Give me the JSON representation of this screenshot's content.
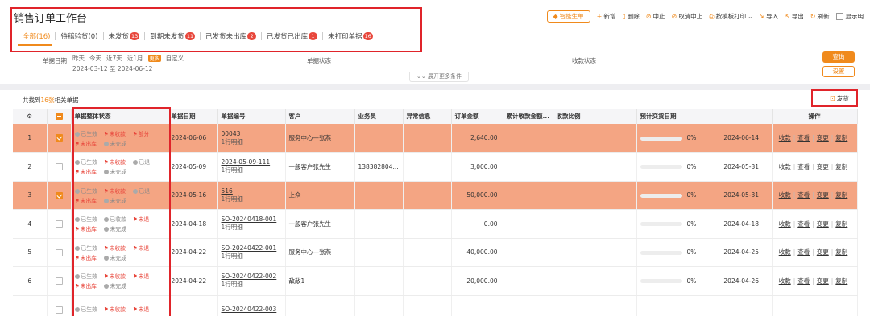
{
  "header": {
    "title": "销售订单工作台"
  },
  "tabs": [
    {
      "label": "全部(16)",
      "badge": ""
    },
    {
      "label": "待稽验货(0)",
      "badge": ""
    },
    {
      "label": "未发货",
      "badge": "13"
    },
    {
      "label": "到期未发货",
      "badge": "11"
    },
    {
      "label": "已发货未出库",
      "badge": "2"
    },
    {
      "label": "已发货已出库",
      "badge": "1"
    },
    {
      "label": "未打印单据",
      "badge": "16"
    }
  ],
  "toolbar": {
    "smart_label": "智能生单",
    "items": [
      "新增",
      "删除",
      "中止",
      "取消中止",
      "按模板打印",
      "导入",
      "导出",
      "刷新"
    ],
    "show_label": "显示明"
  },
  "filters": {
    "date_label": "单据日期",
    "date_opts": [
      "昨天",
      "今天",
      "近7天",
      "近1月"
    ],
    "more_badge": "更多",
    "custom": "自定义",
    "range": "2024-03-12 至 2024-06-12",
    "status_label": "单据状态",
    "collect_label": "收款状态",
    "expand_label": "展开更多条件",
    "query_label": "查询",
    "reset_label": "设置"
  },
  "summary": {
    "prefix": "共找到",
    "count": "16张",
    "suffix": "相关单据"
  },
  "ship_label": "发货",
  "table": {
    "headers": [
      "单据整体状态",
      "单据日期",
      "单据编号",
      "客户",
      "业务员",
      "异常信息",
      "订单金额",
      "累计收款金额...",
      "收款比例",
      "预计交货日期",
      "操作"
    ],
    "ops": [
      "收款",
      "查看",
      "变更",
      "复制"
    ],
    "rows": [
      {
        "idx": "1",
        "checked": true,
        "st": [
          "已生效",
          "未收款",
          "部分",
          "未出库",
          "未完成"
        ],
        "date": "2024-06-06",
        "no": "00043",
        "lines": "1行明细",
        "customer": "服务中心—张燕",
        "sales": "",
        "amount": "2,640.00",
        "ratio": "0%",
        "due": "2024-06-14"
      },
      {
        "idx": "2",
        "checked": false,
        "st": [
          "已生效",
          "未收款",
          "已退",
          "未出库",
          "未完成"
        ],
        "date": "2024-05-09",
        "no": "2024-05-09-111",
        "lines": "1行明细",
        "customer": "一般客户张先生",
        "sales": "138382804...",
        "amount": "3,000.00",
        "ratio": "0%",
        "due": "2024-05-31"
      },
      {
        "idx": "3",
        "checked": true,
        "st": [
          "已生效",
          "未收款",
          "已退",
          "未出库",
          "未完成"
        ],
        "date": "2024-05-16",
        "no": "516",
        "lines": "1行明细",
        "customer": "上众",
        "sales": "",
        "amount": "50,000.00",
        "ratio": "0%",
        "due": "2024-05-31"
      },
      {
        "idx": "4",
        "checked": false,
        "st": [
          "已生效",
          "已收款",
          "未退",
          "未出库",
          "未完成"
        ],
        "date": "2024-04-18",
        "no": "SO-20240418-001",
        "lines": "1行明细",
        "customer": "一般客户张先生",
        "sales": "",
        "amount": "0.00",
        "ratio": "0%",
        "due": "2024-04-18"
      },
      {
        "idx": "5",
        "checked": false,
        "st": [
          "已生效",
          "未收款",
          "未退",
          "未出库",
          "未完成"
        ],
        "date": "2024-04-22",
        "no": "SO-20240422-001",
        "lines": "1行明细",
        "customer": "服务中心—张燕",
        "sales": "",
        "amount": "40,000.00",
        "ratio": "0%",
        "due": "2024-04-25"
      },
      {
        "idx": "6",
        "checked": false,
        "st": [
          "已生效",
          "未收款",
          "未退",
          "未出库",
          "未完成"
        ],
        "date": "2024-04-22",
        "no": "SO-20240422-002",
        "lines": "1行明细",
        "customer": "敌敌1",
        "sales": "",
        "amount": "20,000.00",
        "ratio": "0%",
        "due": "2024-04-26"
      },
      {
        "idx": "",
        "checked": false,
        "st": [
          "已生效",
          "未收款",
          "未退",
          "",
          ""
        ],
        "date": "",
        "no": "SO-20240422-003",
        "lines": "",
        "customer": "",
        "sales": "",
        "amount": "",
        "ratio": "",
        "due": ""
      }
    ]
  },
  "colors": {
    "accent": "#f08a1c",
    "selected_row": "#f4a583",
    "annotation": "#e0242a"
  }
}
